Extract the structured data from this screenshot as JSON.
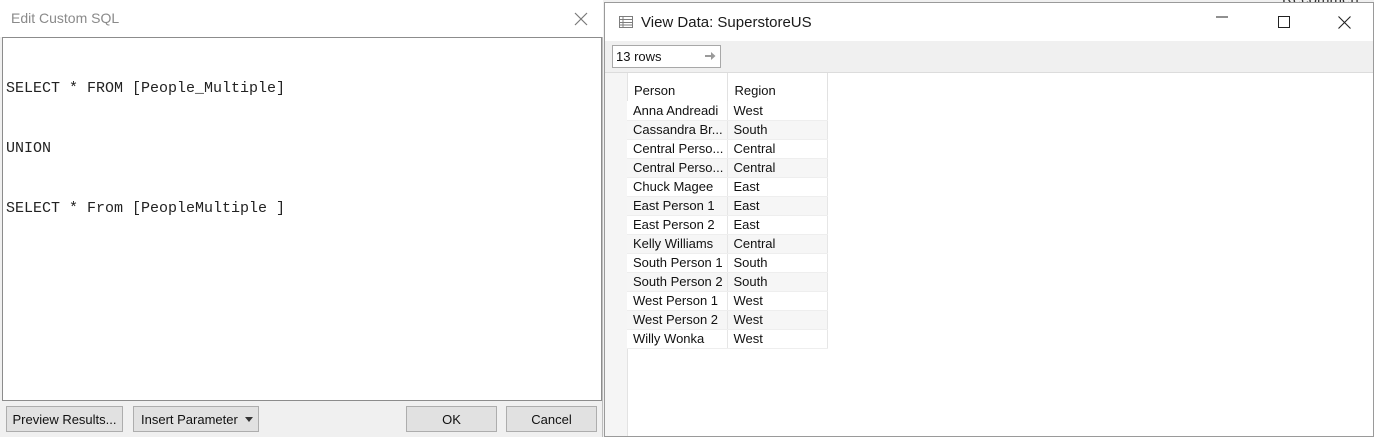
{
  "sql_dialog": {
    "title": "Edit Custom SQL",
    "query_lines": [
      "SELECT * FROM [People_Multiple]",
      "UNION",
      "SELECT * From [PeopleMultiple ]"
    ],
    "buttons": {
      "preview": "Preview Results...",
      "insert_parameter": "Insert Parameter",
      "ok": "OK",
      "cancel": "Cancel"
    }
  },
  "view_data": {
    "title": "View Data:  SuperstoreUS",
    "rows_label": "13 rows",
    "columns": [
      "Person",
      "Region"
    ],
    "rows": [
      [
        "Anna Andreadi",
        "West"
      ],
      [
        "Cassandra Br...",
        "South"
      ],
      [
        "Central Perso...",
        "Central"
      ],
      [
        "Central Perso...",
        "Central"
      ],
      [
        "Chuck Magee",
        "East"
      ],
      [
        "East Person 1",
        "East"
      ],
      [
        "East Person 2",
        "East"
      ],
      [
        "Kelly Williams",
        "Central"
      ],
      [
        "South Person 1",
        "South"
      ],
      [
        "South Person 2",
        "South"
      ],
      [
        "West Person 1",
        "West"
      ],
      [
        "West Person 2",
        "West"
      ],
      [
        "Willy Wonka",
        "West"
      ]
    ]
  },
  "background_text": "Recommen"
}
